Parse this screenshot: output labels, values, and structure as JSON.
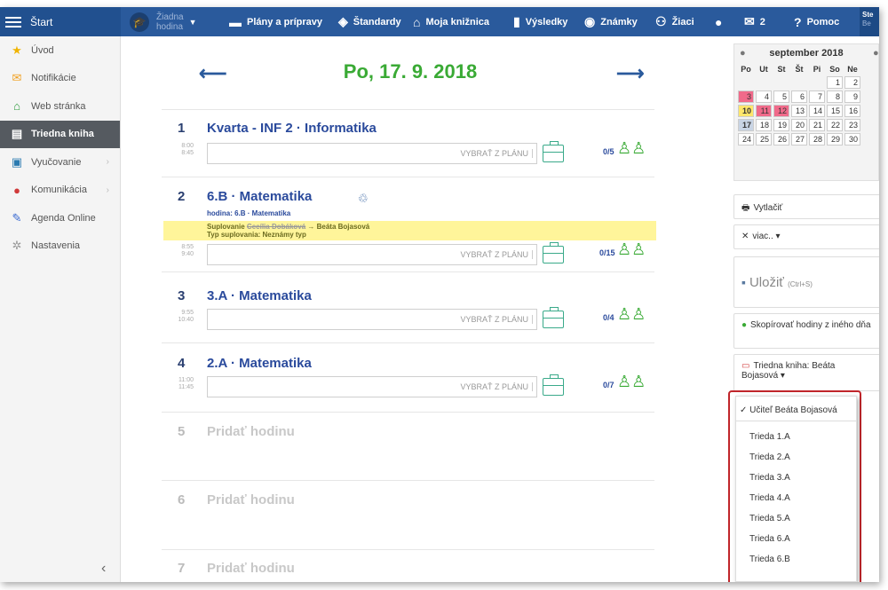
{
  "topbar": {
    "start": "Štart",
    "lesson_label": "Žiadna",
    "lesson_sub": "hodina",
    "nav": [
      {
        "icon": "book-icon",
        "label": "Plány a prípravy"
      },
      {
        "icon": "shield-icon",
        "label": "Štandardy"
      },
      {
        "icon": "library-icon",
        "label": "Moja knižnica"
      },
      {
        "icon": "bar-chart-icon",
        "label": "Výsledky"
      },
      {
        "icon": "grade-icon",
        "label": "Známky"
      },
      {
        "icon": "students-icon",
        "label": "Žiaci"
      }
    ],
    "mail_count": "2",
    "help": "Pomoc",
    "user_line1": "Ste",
    "user_line2": "Be"
  },
  "sidebar": {
    "items": [
      {
        "label": "Úvod",
        "icon": "star-icon"
      },
      {
        "label": "Notifikácie",
        "icon": "envelope-icon"
      },
      {
        "label": "Web stránka",
        "icon": "home-icon"
      },
      {
        "label": "Triedna kniha",
        "icon": "notebook-icon"
      },
      {
        "label": "Vyučovanie",
        "icon": "book-open-icon"
      },
      {
        "label": "Komunikácia",
        "icon": "chat-icon"
      },
      {
        "label": "Agenda Online",
        "icon": "pen-icon"
      },
      {
        "label": "Nastavenia",
        "icon": "gear-icon"
      }
    ]
  },
  "main": {
    "date": "Po, 17. 9. 2018",
    "vybrat": "VYBRAŤ Z PLÁNU",
    "lessons": [
      {
        "num": "1",
        "title": "Kvarta - INF 2 · Informatika",
        "t1": "8:00",
        "t2": "8:45",
        "count": "0/5"
      },
      {
        "num": "2",
        "title": "6.B · Matematika",
        "t1": "8:55",
        "t2": "9:40",
        "count": "0/15"
      },
      {
        "num": "3",
        "title": "3.A · Matematika",
        "t1": "9:55",
        "t2": "10:40",
        "count": "0/4"
      },
      {
        "num": "4",
        "title": "2.A · Matematika",
        "t1": "11:00",
        "t2": "11:45",
        "count": "0/7"
      },
      {
        "num": "5",
        "title": "Pridať hodinu"
      },
      {
        "num": "6",
        "title": "Pridať hodinu"
      },
      {
        "num": "7",
        "title": "Pridať hodinu"
      }
    ],
    "hodina_info": "hodina: 6.B · Matematika",
    "sub_label": "Suplovanie",
    "sub_from": "Cecília Dobáková",
    "sub_to": "→ Beáta Bojasová",
    "sub_type": "Typ suplovania: Neznámy typ"
  },
  "calendar": {
    "month": "september 2018",
    "days": [
      "Po",
      "Ut",
      "St",
      "Št",
      "Pi",
      "So",
      "Ne"
    ]
  },
  "right": {
    "print": "Vytlačiť",
    "more": "viac.. ▾",
    "save": "Uložiť",
    "save_hint": "(Ctrl+S)",
    "copy": "Skopírovať hodiny z iného dňa",
    "book": "Triedna kniha: Beáta Bojasová ▾"
  },
  "dropdown": {
    "selected": "✓ Učiteľ Beáta Bojasová",
    "items": [
      "Trieda 1.A",
      "Trieda 2.A",
      "Trieda 3.A",
      "Trieda 4.A",
      "Trieda 5.A",
      "Trieda 6.A",
      "Trieda 6.B"
    ]
  }
}
